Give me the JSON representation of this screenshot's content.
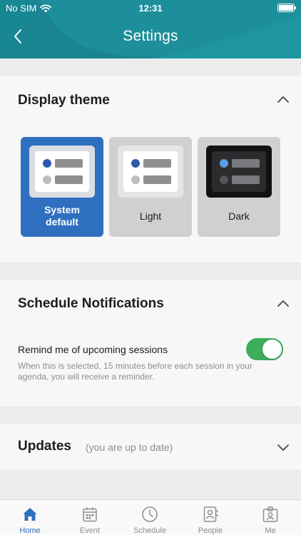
{
  "status_bar": {
    "carrier": "No SIM",
    "time": "12:31"
  },
  "header": {
    "title": "Settings"
  },
  "display_theme": {
    "title": "Display theme",
    "options": [
      {
        "label": "System default",
        "selected": true
      },
      {
        "label": "Light",
        "selected": false
      },
      {
        "label": "Dark",
        "selected": false
      }
    ]
  },
  "schedule_notifications": {
    "title": "Schedule Notifications",
    "remind_label": "Remind me of upcoming sessions",
    "remind_description": "When this is selected, 15 minutes before each session in your agenda, you will receive a reminder.",
    "remind_enabled": true
  },
  "updates": {
    "title": "Updates",
    "status": "(you are up to date)"
  },
  "tabbar": {
    "tabs": [
      {
        "label": "Home",
        "icon": "home-icon",
        "active": true
      },
      {
        "label": "Event",
        "icon": "calendar-icon",
        "active": false
      },
      {
        "label": "Schedule",
        "icon": "clock-icon",
        "active": false
      },
      {
        "label": "People",
        "icon": "contact-card-icon",
        "active": false
      },
      {
        "label": "Me",
        "icon": "badge-icon",
        "active": false
      }
    ]
  },
  "colors": {
    "header": "#1d8f9a",
    "accent": "#2f6fbf",
    "toggle_on": "#3cae5c"
  }
}
